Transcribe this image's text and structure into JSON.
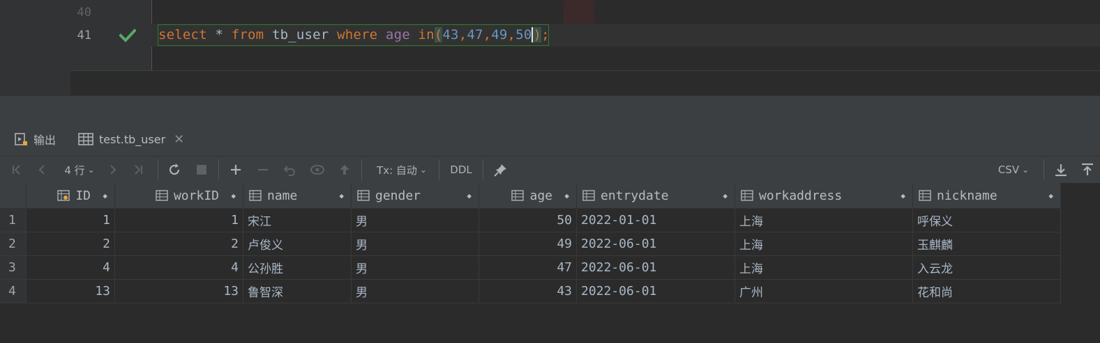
{
  "editor": {
    "line_numbers": [
      "40",
      "41"
    ],
    "code": {
      "t1": "select",
      "t2": " * ",
      "t3": "from",
      "t4": " tb_user ",
      "t5": "where",
      "t6": " age ",
      "t7": "in",
      "t8": "(",
      "t9": "43",
      "t10": ",",
      "t11": "47",
      "t12": ",",
      "t13": "49",
      "t14": ",",
      "t15": "50",
      "t16": ")",
      "t17": ";"
    }
  },
  "panel": {
    "tabs": [
      {
        "label": "输出",
        "icon": "output-icon"
      },
      {
        "label": "test.tb_user",
        "icon": "table-icon"
      }
    ],
    "toolbar": {
      "row_count": "4 行",
      "tx_label": "Tx: 自动",
      "ddl_label": "DDL",
      "export_format": "CSV"
    }
  },
  "grid": {
    "columns": [
      "ID",
      "workID",
      "name",
      "gender",
      "age",
      "entrydate",
      "workaddress",
      "nickname"
    ],
    "rows": [
      {
        "n": "1",
        "id": "1",
        "workid": "1",
        "name": "宋江",
        "gender": "男",
        "age": "50",
        "entrydate": "2022-01-01",
        "workaddress": "上海",
        "nickname": "呼保义"
      },
      {
        "n": "2",
        "id": "2",
        "workid": "2",
        "name": "卢俊义",
        "gender": "男",
        "age": "49",
        "entrydate": "2022-06-01",
        "workaddress": "上海",
        "nickname": "玉麒麟"
      },
      {
        "n": "3",
        "id": "4",
        "workid": "4",
        "name": "公孙胜",
        "gender": "男",
        "age": "47",
        "entrydate": "2022-06-01",
        "workaddress": "上海",
        "nickname": "入云龙"
      },
      {
        "n": "4",
        "id": "13",
        "workid": "13",
        "name": "鲁智深",
        "gender": "男",
        "age": "43",
        "entrydate": "2022-06-01",
        "workaddress": "广州",
        "nickname": "花和尚"
      }
    ]
  },
  "colors": {
    "keyword": "#cc7832",
    "number": "#6897bb",
    "function": "#9876aa",
    "check": "#59a869",
    "accent": "#4a88c7"
  }
}
